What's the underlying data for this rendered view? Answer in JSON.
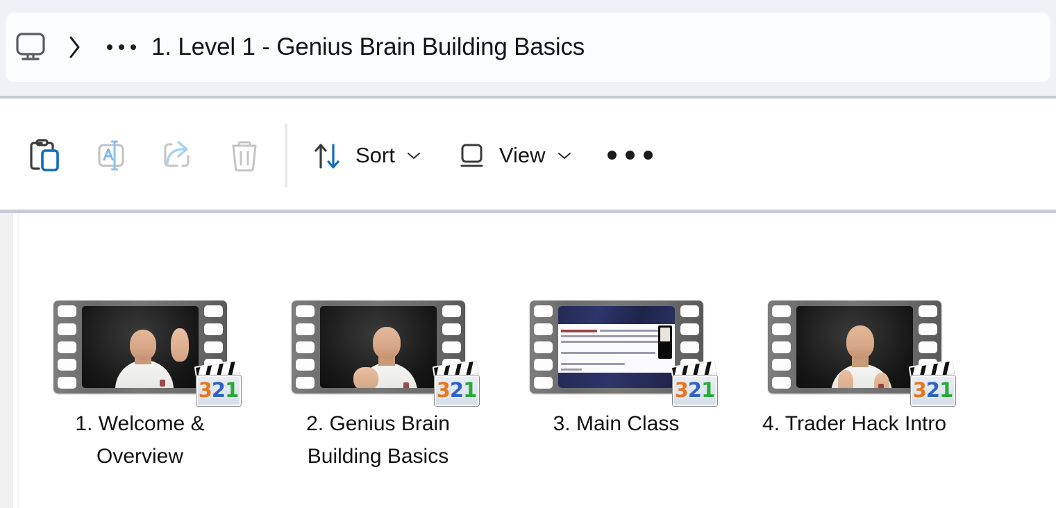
{
  "window": {
    "app": "File Explorer",
    "breadcrumb": {
      "root_icon": "monitor-icon",
      "separator": "›",
      "overflow": "•••",
      "title": "1. Level 1 - Genius Brain Building Basics"
    }
  },
  "toolbar": {
    "buttons": [
      {
        "name": "paste-button",
        "icon": "clipboard-paste-icon",
        "label": "",
        "enabled": true
      },
      {
        "name": "rename-button",
        "icon": "rename-icon",
        "label": "",
        "enabled": false
      },
      {
        "name": "share-button",
        "icon": "share-icon",
        "label": "",
        "enabled": false
      },
      {
        "name": "delete-button",
        "icon": "trash-icon",
        "label": "",
        "enabled": false
      }
    ],
    "sort": {
      "label": "Sort",
      "icon": "sort-arrows-icon",
      "chevron": "⌄"
    },
    "view": {
      "label": "View",
      "icon": "view-layout-icon",
      "chevron": "⌄"
    },
    "more": {
      "label": "See more",
      "icon": "ellipsis-icon"
    }
  },
  "content": {
    "layout": "large-icons",
    "files": [
      {
        "name": "1. Welcome & Overview",
        "thumb_type": "video-person",
        "badge": "mpc-321-icon"
      },
      {
        "name": "2. Genius Brain Building Basics",
        "thumb_type": "video-person",
        "badge": "mpc-321-icon"
      },
      {
        "name": "3. Main Class",
        "thumb_type": "video-slide",
        "badge": "mpc-321-icon"
      },
      {
        "name": "4. Trader Hack Intro",
        "thumb_type": "video-person",
        "badge": "mpc-321-icon"
      }
    ]
  },
  "colors": {
    "titlebar_bg": "#eef1f6",
    "addressbar_bg": "#fbfcfd",
    "divider": "#c5cbd7",
    "content_bg": "#ffffff",
    "accent_blue": "#0f6cbd",
    "disabled_grey": "#c2c2c2",
    "text": "#141414",
    "badge_3": "#e8761e",
    "badge_2": "#2d63c8",
    "badge_1": "#2aa93a"
  },
  "badge_digits": {
    "d3": "3",
    "d2": "2",
    "d1": "1"
  }
}
